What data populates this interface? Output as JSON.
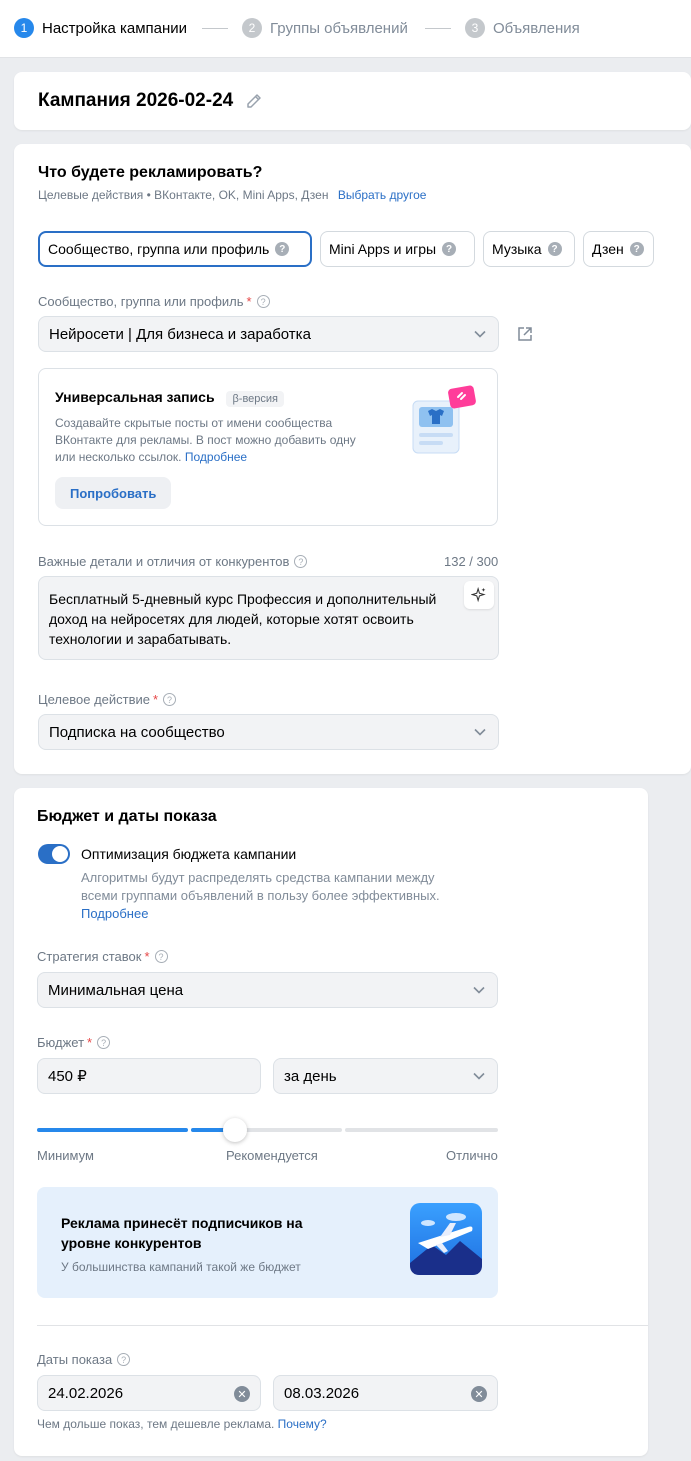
{
  "stepper": {
    "steps": [
      {
        "num": "1",
        "label": "Настройка кампании"
      },
      {
        "num": "2",
        "label": "Группы объявлений"
      },
      {
        "num": "3",
        "label": "Объявления"
      }
    ]
  },
  "campaign": {
    "title": "Кампания 2026-02-24"
  },
  "promote": {
    "heading": "Что будете рекламировать?",
    "subtext": "Целевые действия • ВКонтакте, OK, Mini Apps, Дзен",
    "choose_other": "Выбрать другое",
    "chips": [
      {
        "label": "Сообщество, группа или профиль"
      },
      {
        "label": "Mini Apps и игры"
      },
      {
        "label": "Музыка"
      },
      {
        "label": "Дзен"
      }
    ],
    "community_label": "Сообщество, группа или профиль",
    "community_value": "Нейросети | Для бизнеса и заработка"
  },
  "promo_card": {
    "title": "Универсальная запись",
    "badge": "β-версия",
    "text": "Создавайте скрытые посты от имени сообщества ВКонтакте для рекламы. В пост можно добавить одну или несколько ссылок.",
    "more_link": "Подробнее",
    "button": "Попробовать"
  },
  "details": {
    "label": "Важные детали и отличия от конкурентов",
    "counter": "132 / 300",
    "value": "Бесплатный 5-дневный курс Профессия и дополнительный доход на нейросетях для людей, которые хотят освоить технологии и зарабатывать."
  },
  "target_action": {
    "label": "Целевое действие",
    "value": "Подписка на сообщество"
  },
  "budget": {
    "heading": "Бюджет и даты показа",
    "toggle_label": "Оптимизация бюджета кампании",
    "toggle_on": true,
    "toggle_desc": "Алгоритмы будут распределять средства кампании между всеми группами объявлений в пользу более эффективных.",
    "toggle_more": "Подробнее",
    "strategy_label": "Стратегия ставок",
    "strategy_value": "Минимальная цена",
    "budget_label": "Бюджет",
    "budget_value": "450 ₽",
    "period_value": "за день",
    "slider_labels": {
      "min": "Минимум",
      "mid": "Рекомендуется",
      "max": "Отлично"
    },
    "slider_level": 0.43,
    "tip_title": "Реклама принесёт подписчиков на уровне конкурентов",
    "tip_sub": "У большинства кампаний такой же бюджет",
    "dates_label": "Даты показа",
    "date_start": "24.02.2026",
    "date_end": "08.03.2026",
    "dates_hint": "Чем дольше показ, тем дешевле реклама.",
    "dates_hint_link": "Почему?"
  },
  "colors": {
    "accent": "#2688eb",
    "link": "#2a6fc6",
    "required": "#e64646"
  }
}
